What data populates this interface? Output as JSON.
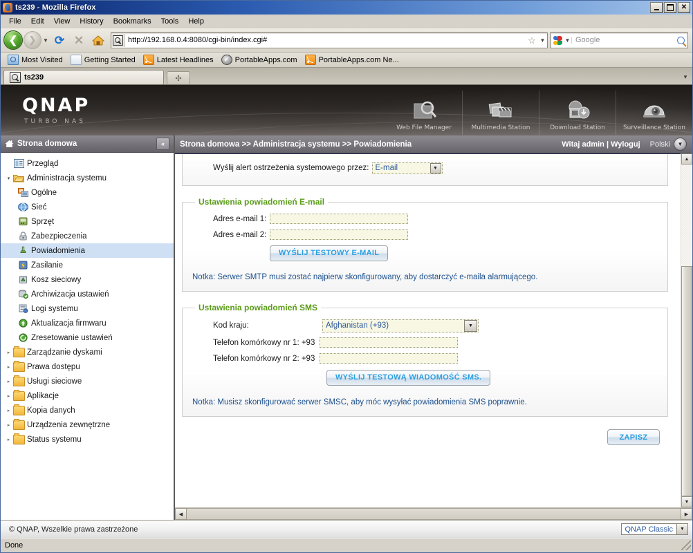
{
  "window": {
    "title": "ts239 - Mozilla Firefox",
    "minimize": "_",
    "maximize": "□",
    "close": "✕"
  },
  "menubar": [
    {
      "label": "File"
    },
    {
      "label": "Edit"
    },
    {
      "label": "View"
    },
    {
      "label": "History"
    },
    {
      "label": "Bookmarks"
    },
    {
      "label": "Tools"
    },
    {
      "label": "Help"
    }
  ],
  "toolbar": {
    "back_glyph": "❮",
    "forward_glyph": "❯",
    "dropdown_glyph": "▼",
    "reload_glyph": "⟳",
    "stop_glyph": "✕",
    "url": "http://192.168.0.4:8080/cgi-bin/index.cgi#",
    "star_glyph": "☆",
    "search_placeholder": "Google"
  },
  "bookmarks": [
    {
      "label": "Most Visited",
      "icon": "most-visited-icon"
    },
    {
      "label": "Getting Started",
      "icon": "page-icon"
    },
    {
      "label": "Latest Headlines",
      "icon": "rss-icon"
    },
    {
      "label": "PortableApps.com",
      "icon": "portableapps-icon"
    },
    {
      "label": "PortableApps.com Ne...",
      "icon": "rss-icon"
    }
  ],
  "tabs": {
    "active_label": "ts239",
    "new_tab_glyph": "✣",
    "list_glyph": "▾"
  },
  "banner": {
    "logo": "QNAP",
    "tagline": "TURBO NAS",
    "stations": [
      {
        "label": "Web File Manager",
        "icon": "folder-search-icon"
      },
      {
        "label": "Multimedia Station",
        "icon": "photos-clapperboard-icon"
      },
      {
        "label": "Download Station",
        "icon": "download-monitor-icon"
      },
      {
        "label": "Surveillance Station",
        "icon": "dome-camera-icon"
      }
    ]
  },
  "sidebar": {
    "header": "Strona domowa",
    "header_icon": "home-icon",
    "collapse_glyph": "«",
    "items": [
      {
        "label": "Przegląd",
        "level": 1,
        "arrow": "",
        "icon": "overview-icon",
        "selected": false
      },
      {
        "label": "Administracja systemu",
        "level": 1,
        "arrow": "▾",
        "icon": "folder-open-icon",
        "selected": false
      },
      {
        "label": "Ogólne",
        "level": 2,
        "arrow": "",
        "icon": "general-icon",
        "selected": false
      },
      {
        "label": "Sieć",
        "level": 2,
        "arrow": "",
        "icon": "network-icon",
        "selected": false
      },
      {
        "label": "Sprzęt",
        "level": 2,
        "arrow": "",
        "icon": "hardware-icon",
        "selected": false
      },
      {
        "label": "Zabezpieczenia",
        "level": 2,
        "arrow": "",
        "icon": "security-lock-icon",
        "selected": false
      },
      {
        "label": "Powiadomienia",
        "level": 2,
        "arrow": "",
        "icon": "notification-icon",
        "selected": true
      },
      {
        "label": "Zasilanie",
        "level": 2,
        "arrow": "",
        "icon": "power-icon",
        "selected": false
      },
      {
        "label": "Kosz sieciowy",
        "level": 2,
        "arrow": "",
        "icon": "recycle-bin-icon",
        "selected": false
      },
      {
        "label": "Archiwizacja ustawień",
        "level": 2,
        "arrow": "",
        "icon": "backup-icon",
        "selected": false
      },
      {
        "label": "Logi systemu",
        "level": 2,
        "arrow": "",
        "icon": "logs-icon",
        "selected": false
      },
      {
        "label": "Aktualizacja firmwaru",
        "level": 2,
        "arrow": "",
        "icon": "firmware-update-icon",
        "selected": false
      },
      {
        "label": "Zresetowanie ustawień",
        "level": 2,
        "arrow": "",
        "icon": "reset-icon",
        "selected": false
      },
      {
        "label": "Zarządzanie dyskami",
        "level": 1,
        "arrow": "▸",
        "icon": "folder-icon",
        "selected": false
      },
      {
        "label": "Prawa dostępu",
        "level": 1,
        "arrow": "▸",
        "icon": "folder-icon",
        "selected": false
      },
      {
        "label": "Usługi sieciowe",
        "level": 1,
        "arrow": "▸",
        "icon": "folder-icon",
        "selected": false
      },
      {
        "label": "Aplikacje",
        "level": 1,
        "arrow": "▸",
        "icon": "folder-icon",
        "selected": false
      },
      {
        "label": "Kopia danych",
        "level": 1,
        "arrow": "▸",
        "icon": "folder-icon",
        "selected": false
      },
      {
        "label": "Urządzenia zewnętrzne",
        "level": 1,
        "arrow": "▸",
        "icon": "folder-icon",
        "selected": false
      },
      {
        "label": "Status systemu",
        "level": 1,
        "arrow": "▸",
        "icon": "folder-icon",
        "selected": false
      }
    ]
  },
  "breadcrumb": {
    "path": "Strona domowa >> Administracja systemu >> Powiadomienia",
    "welcome": "Witaj admin | Wyloguj",
    "language": "Polski",
    "language_glyph": "▼"
  },
  "main": {
    "alert_row": {
      "label": "Wyślij alert ostrzeżenia systemowego przez:",
      "value": "E-mail",
      "arrow": "▼"
    },
    "email_section": {
      "legend": "Ustawienia powiadomień E-mail",
      "fields": [
        {
          "label": "Adres e-mail 1:",
          "value": "",
          "placeholder": ""
        },
        {
          "label": "Adres e-mail 2:",
          "value": "",
          "placeholder": ""
        }
      ],
      "test_button": "WYŚLIJ TESTOWY E-MAIL",
      "note": "Notka: Serwer SMTP musi zostać najpierw skonfigurowany, aby dostarczyć e-maila alarmującego."
    },
    "sms_section": {
      "legend": "Ustawienia powiadomień SMS",
      "country_label": "Kod kraju:",
      "country_value": "Afghanistan (+93)",
      "country_arrow": "▼",
      "fields": [
        {
          "label": "Telefon komórkowy nr 1: +93",
          "value": ""
        },
        {
          "label": "Telefon komórkowy nr 2: +93",
          "value": ""
        }
      ],
      "test_button": "WYŚLIJ TESTOWĄ WIADOMOŚĆ SMS.",
      "note": "Notka: Musisz skonfigurować serwer SMSC, aby móc wysyłać powiadomienia SMS poprawnie."
    },
    "save_button": "ZAPISZ"
  },
  "scrollbars": {
    "up_glyph": "▲",
    "down_glyph": "▼",
    "left_glyph": "◀",
    "right_glyph": "▶"
  },
  "footer": {
    "copyright": "© QNAP, Wszelkie prawa zastrzeżone",
    "theme": "QNAP Classic",
    "theme_arrow": "▼"
  },
  "statusbar": {
    "text": "Done"
  },
  "colors": {
    "accent_green": "#5a9c18",
    "link_blue": "#2b9fe0",
    "note_blue": "#1b4f8c",
    "selection": "#cfe0f5",
    "titlebar": "#0a246a"
  }
}
